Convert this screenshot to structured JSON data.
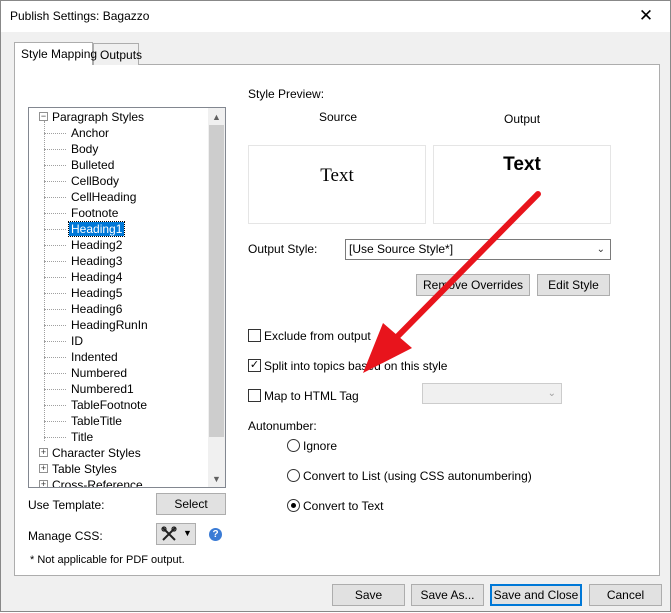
{
  "window": {
    "title": "Publish Settings: Bagazzo",
    "close_glyph": "✕"
  },
  "tabs": [
    {
      "label": "Style Mapping",
      "active": true
    },
    {
      "label": "Outputs",
      "active": false
    }
  ],
  "tree": {
    "root": {
      "label": "Paragraph Styles",
      "expanded": true
    },
    "paragraph_styles": [
      "Anchor",
      "Body",
      "Bulleted",
      "CellBody",
      "CellHeading",
      "Footnote",
      "Heading1",
      "Heading2",
      "Heading3",
      "Heading4",
      "Heading5",
      "Heading6",
      "HeadingRunIn",
      "ID",
      "Indented",
      "Numbered",
      "Numbered1",
      "TableFootnote",
      "TableTitle",
      "Title"
    ],
    "selected": "Heading1",
    "other_groups": [
      {
        "label": "Character Styles",
        "expanded": false
      },
      {
        "label": "Table Styles",
        "expanded": false
      },
      {
        "label": "Cross-Reference",
        "expanded": false
      }
    ]
  },
  "left_controls": {
    "use_template_label": "Use Template:",
    "select_button": "Select",
    "manage_css_label": "Manage CSS:",
    "note": "* Not applicable for PDF output."
  },
  "style_preview": {
    "label": "Style Preview:",
    "source_label": "Source",
    "output_label": "Output",
    "source_text": "Text",
    "output_text": "Text"
  },
  "output_style": {
    "label": "Output Style:",
    "value": "[Use Source Style*]",
    "remove_overrides": "Remove Overrides",
    "edit_style": "Edit Style"
  },
  "options": {
    "exclude": {
      "label": "Exclude from output",
      "checked": false
    },
    "split": {
      "label": "Split into topics based on this style",
      "checked": true
    },
    "map_html": {
      "label": "Map to HTML Tag",
      "checked": false,
      "value": ""
    }
  },
  "autonumber": {
    "label": "Autonumber:",
    "options": [
      {
        "label": "Ignore",
        "checked": false
      },
      {
        "label": "Convert to List (using CSS autonumbering)",
        "checked": false
      },
      {
        "label": "Convert to Text",
        "checked": true
      }
    ]
  },
  "footer": {
    "save": "Save",
    "save_as": "Save As...",
    "save_close": "Save and Close",
    "cancel": "Cancel"
  },
  "colors": {
    "selection": "#0078d7",
    "annotation_arrow": "#e8141c"
  }
}
